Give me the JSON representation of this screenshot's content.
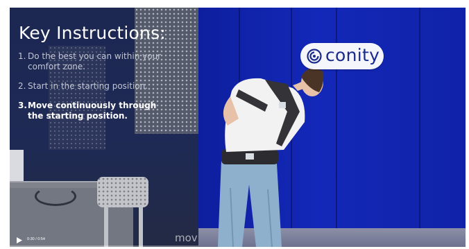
{
  "overlay": {
    "title": "Key Instructions:",
    "steps": [
      {
        "number": "1.",
        "text": "Do the best you can within your comfort zone."
      },
      {
        "number": "2.",
        "text": "Start in the starting position."
      },
      {
        "number": "3.",
        "text": "Move continuously through the starting position."
      }
    ]
  },
  "brand": {
    "logo_text": "conity",
    "logo_icon": "conity-logo-icon",
    "logo_color": "#1a2a8c"
  },
  "watermark": {
    "text": "mov"
  },
  "player": {
    "play_icon": "play-icon",
    "time": "0:30 / 0:54",
    "progress": 0.0
  },
  "colors": {
    "wall_blue": "#1328b8",
    "text_white": "#ffffff",
    "text_dim": "#c2c6d3"
  }
}
